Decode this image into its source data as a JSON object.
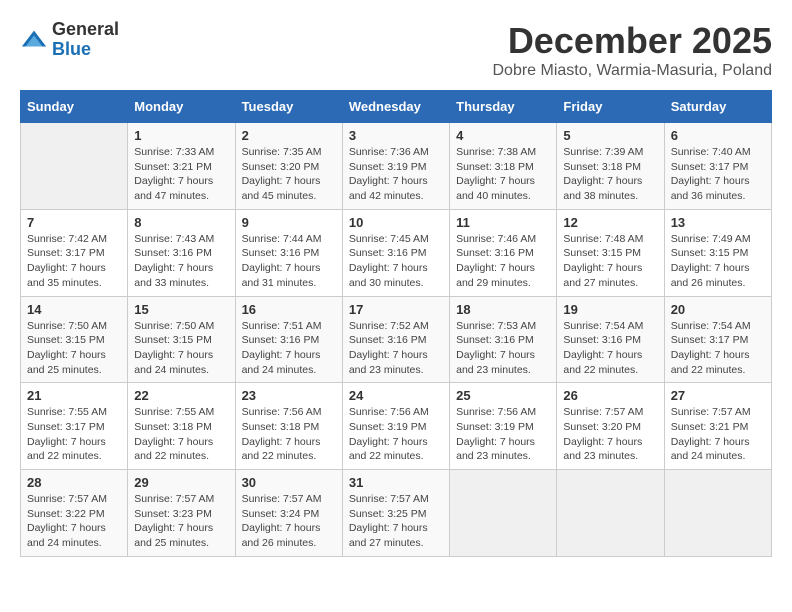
{
  "header": {
    "logo_line1": "General",
    "logo_line2": "Blue",
    "month_title": "December 2025",
    "location": "Dobre Miasto, Warmia-Masuria, Poland"
  },
  "weekdays": [
    "Sunday",
    "Monday",
    "Tuesday",
    "Wednesday",
    "Thursday",
    "Friday",
    "Saturday"
  ],
  "weeks": [
    [
      {
        "day": "",
        "sunrise": "",
        "sunset": "",
        "daylight": ""
      },
      {
        "day": "1",
        "sunrise": "Sunrise: 7:33 AM",
        "sunset": "Sunset: 3:21 PM",
        "daylight": "Daylight: 7 hours and 47 minutes."
      },
      {
        "day": "2",
        "sunrise": "Sunrise: 7:35 AM",
        "sunset": "Sunset: 3:20 PM",
        "daylight": "Daylight: 7 hours and 45 minutes."
      },
      {
        "day": "3",
        "sunrise": "Sunrise: 7:36 AM",
        "sunset": "Sunset: 3:19 PM",
        "daylight": "Daylight: 7 hours and 42 minutes."
      },
      {
        "day": "4",
        "sunrise": "Sunrise: 7:38 AM",
        "sunset": "Sunset: 3:18 PM",
        "daylight": "Daylight: 7 hours and 40 minutes."
      },
      {
        "day": "5",
        "sunrise": "Sunrise: 7:39 AM",
        "sunset": "Sunset: 3:18 PM",
        "daylight": "Daylight: 7 hours and 38 minutes."
      },
      {
        "day": "6",
        "sunrise": "Sunrise: 7:40 AM",
        "sunset": "Sunset: 3:17 PM",
        "daylight": "Daylight: 7 hours and 36 minutes."
      }
    ],
    [
      {
        "day": "7",
        "sunrise": "Sunrise: 7:42 AM",
        "sunset": "Sunset: 3:17 PM",
        "daylight": "Daylight: 7 hours and 35 minutes."
      },
      {
        "day": "8",
        "sunrise": "Sunrise: 7:43 AM",
        "sunset": "Sunset: 3:16 PM",
        "daylight": "Daylight: 7 hours and 33 minutes."
      },
      {
        "day": "9",
        "sunrise": "Sunrise: 7:44 AM",
        "sunset": "Sunset: 3:16 PM",
        "daylight": "Daylight: 7 hours and 31 minutes."
      },
      {
        "day": "10",
        "sunrise": "Sunrise: 7:45 AM",
        "sunset": "Sunset: 3:16 PM",
        "daylight": "Daylight: 7 hours and 30 minutes."
      },
      {
        "day": "11",
        "sunrise": "Sunrise: 7:46 AM",
        "sunset": "Sunset: 3:16 PM",
        "daylight": "Daylight: 7 hours and 29 minutes."
      },
      {
        "day": "12",
        "sunrise": "Sunrise: 7:48 AM",
        "sunset": "Sunset: 3:15 PM",
        "daylight": "Daylight: 7 hours and 27 minutes."
      },
      {
        "day": "13",
        "sunrise": "Sunrise: 7:49 AM",
        "sunset": "Sunset: 3:15 PM",
        "daylight": "Daylight: 7 hours and 26 minutes."
      }
    ],
    [
      {
        "day": "14",
        "sunrise": "Sunrise: 7:50 AM",
        "sunset": "Sunset: 3:15 PM",
        "daylight": "Daylight: 7 hours and 25 minutes."
      },
      {
        "day": "15",
        "sunrise": "Sunrise: 7:50 AM",
        "sunset": "Sunset: 3:15 PM",
        "daylight": "Daylight: 7 hours and 24 minutes."
      },
      {
        "day": "16",
        "sunrise": "Sunrise: 7:51 AM",
        "sunset": "Sunset: 3:16 PM",
        "daylight": "Daylight: 7 hours and 24 minutes."
      },
      {
        "day": "17",
        "sunrise": "Sunrise: 7:52 AM",
        "sunset": "Sunset: 3:16 PM",
        "daylight": "Daylight: 7 hours and 23 minutes."
      },
      {
        "day": "18",
        "sunrise": "Sunrise: 7:53 AM",
        "sunset": "Sunset: 3:16 PM",
        "daylight": "Daylight: 7 hours and 23 minutes."
      },
      {
        "day": "19",
        "sunrise": "Sunrise: 7:54 AM",
        "sunset": "Sunset: 3:16 PM",
        "daylight": "Daylight: 7 hours and 22 minutes."
      },
      {
        "day": "20",
        "sunrise": "Sunrise: 7:54 AM",
        "sunset": "Sunset: 3:17 PM",
        "daylight": "Daylight: 7 hours and 22 minutes."
      }
    ],
    [
      {
        "day": "21",
        "sunrise": "Sunrise: 7:55 AM",
        "sunset": "Sunset: 3:17 PM",
        "daylight": "Daylight: 7 hours and 22 minutes."
      },
      {
        "day": "22",
        "sunrise": "Sunrise: 7:55 AM",
        "sunset": "Sunset: 3:18 PM",
        "daylight": "Daylight: 7 hours and 22 minutes."
      },
      {
        "day": "23",
        "sunrise": "Sunrise: 7:56 AM",
        "sunset": "Sunset: 3:18 PM",
        "daylight": "Daylight: 7 hours and 22 minutes."
      },
      {
        "day": "24",
        "sunrise": "Sunrise: 7:56 AM",
        "sunset": "Sunset: 3:19 PM",
        "daylight": "Daylight: 7 hours and 22 minutes."
      },
      {
        "day": "25",
        "sunrise": "Sunrise: 7:56 AM",
        "sunset": "Sunset: 3:19 PM",
        "daylight": "Daylight: 7 hours and 23 minutes."
      },
      {
        "day": "26",
        "sunrise": "Sunrise: 7:57 AM",
        "sunset": "Sunset: 3:20 PM",
        "daylight": "Daylight: 7 hours and 23 minutes."
      },
      {
        "day": "27",
        "sunrise": "Sunrise: 7:57 AM",
        "sunset": "Sunset: 3:21 PM",
        "daylight": "Daylight: 7 hours and 24 minutes."
      }
    ],
    [
      {
        "day": "28",
        "sunrise": "Sunrise: 7:57 AM",
        "sunset": "Sunset: 3:22 PM",
        "daylight": "Daylight: 7 hours and 24 minutes."
      },
      {
        "day": "29",
        "sunrise": "Sunrise: 7:57 AM",
        "sunset": "Sunset: 3:23 PM",
        "daylight": "Daylight: 7 hours and 25 minutes."
      },
      {
        "day": "30",
        "sunrise": "Sunrise: 7:57 AM",
        "sunset": "Sunset: 3:24 PM",
        "daylight": "Daylight: 7 hours and 26 minutes."
      },
      {
        "day": "31",
        "sunrise": "Sunrise: 7:57 AM",
        "sunset": "Sunset: 3:25 PM",
        "daylight": "Daylight: 7 hours and 27 minutes."
      },
      {
        "day": "",
        "sunrise": "",
        "sunset": "",
        "daylight": ""
      },
      {
        "day": "",
        "sunrise": "",
        "sunset": "",
        "daylight": ""
      },
      {
        "day": "",
        "sunrise": "",
        "sunset": "",
        "daylight": ""
      }
    ]
  ]
}
